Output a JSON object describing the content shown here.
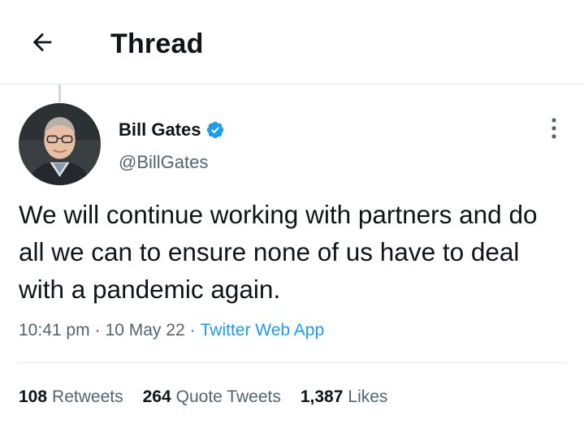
{
  "header": {
    "back_icon": "arrow-left-icon",
    "title": "Thread"
  },
  "tweet": {
    "author": {
      "name": "Bill Gates",
      "handle": "@BillGates",
      "verified_icon": "verified-badge-icon",
      "verified_color": "#1d9bf0"
    },
    "more_icon": "more-vertical-icon",
    "text": "We will continue working with partners and do all we can to ensure none of us have to deal with a pandemic again.",
    "time": "10:41 pm",
    "date": "10 May 22",
    "source": "Twitter Web App",
    "separator": "·"
  },
  "stats": {
    "retweets_count": "108",
    "retweets_label": "Retweets",
    "quotes_count": "264",
    "quotes_label": "Quote Tweets",
    "likes_count": "1,387",
    "likes_label": "Likes"
  },
  "colors": {
    "accent": "#1d9bf0",
    "secondary_text": "#536471",
    "primary_text": "#0f1419",
    "divider": "#e6e9eb"
  }
}
